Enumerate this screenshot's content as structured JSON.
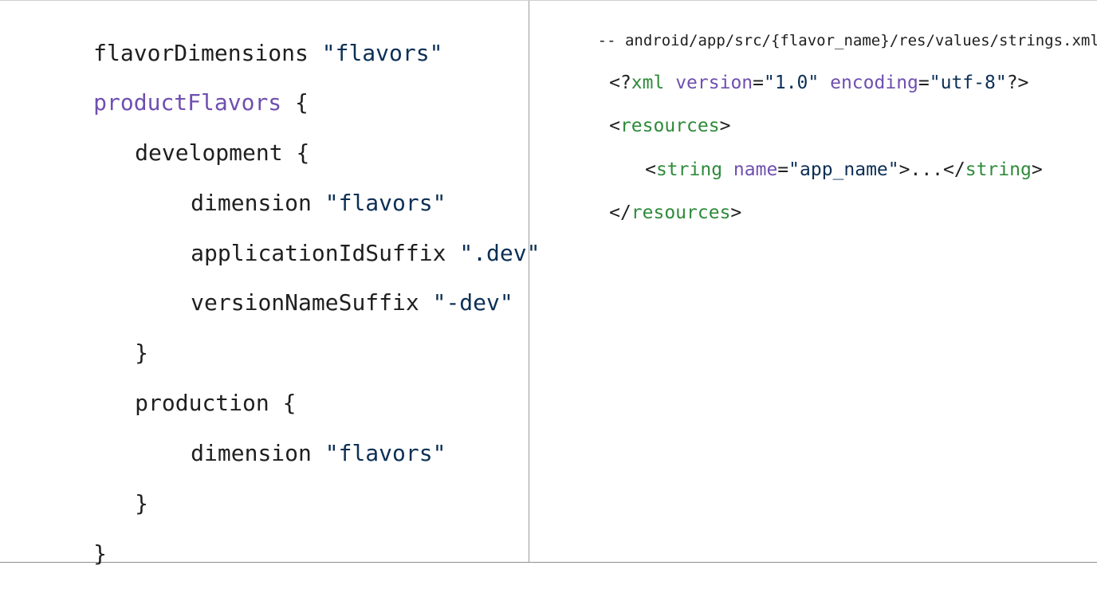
{
  "left_code": {
    "line1": {
      "a": "flavorDimensions ",
      "b": "\"flavors\""
    },
    "line2": {
      "a": "productFlavors",
      "b": " {"
    },
    "line3": {
      "a": "development {"
    },
    "line4": {
      "a": "dimension ",
      "b": "\"flavors\""
    },
    "line5": {
      "a": "applicationIdSuffix ",
      "b": "\".dev\""
    },
    "line6": {
      "a": "versionNameSuffix ",
      "b": "\"-dev\""
    },
    "line7": {
      "a": "}"
    },
    "line8": {
      "a": "production {"
    },
    "line9": {
      "a": "dimension ",
      "b": "\"flavors\""
    },
    "line10": {
      "a": "}"
    },
    "line11": {
      "a": "}"
    }
  },
  "right_code": {
    "comment": "-- android/app/src/{flavor_name}/res/values/strings.xml",
    "xml_decl": {
      "p1": "<?",
      "tag": "xml",
      "sp1": " ",
      "attr1": "version",
      "eq1": "=",
      "val1": "\"1.0\"",
      "sp2": " ",
      "attr2": "encoding",
      "eq2": "=",
      "val2": "\"utf-8\"",
      "p2": "?>"
    },
    "resources_open": {
      "lt": "<",
      "tag": "resources",
      "gt": ">"
    },
    "string_line": {
      "lt": "<",
      "tag": "string",
      "sp": " ",
      "attr": "name",
      "eq": "=",
      "val": "\"app_name\"",
      "mid": ">...</",
      "tag2": "string",
      "gt": ">"
    },
    "resources_close": {
      "lt": "</",
      "tag": "resources",
      "gt": ">"
    }
  }
}
